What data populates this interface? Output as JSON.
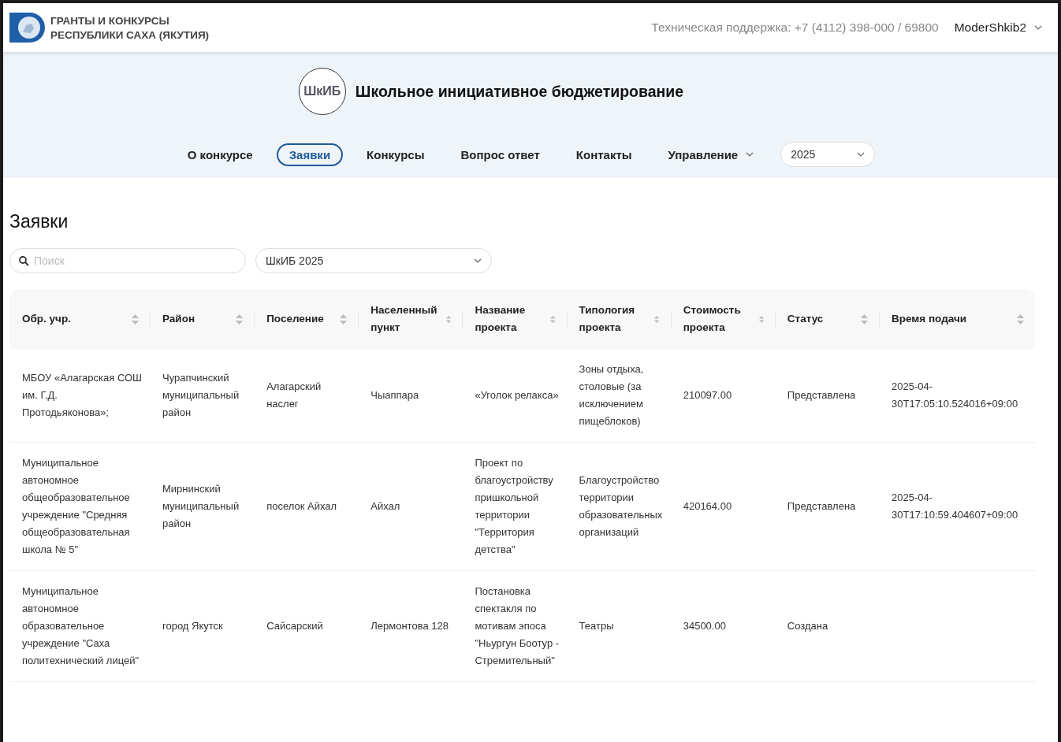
{
  "header": {
    "org_lines": [
      "ГРАНТЫ И КОНКУРСЫ",
      "РЕСПУБЛИКИ САХА (ЯКУТИЯ)"
    ],
    "support": "Техническая поддержка: +7 (4112) 398-000 / 69800",
    "user": "ModerShkib2"
  },
  "banner": {
    "logo_text": "ШкИБ",
    "title": "Школьное инициативное бюджетирование"
  },
  "nav": [
    {
      "label": "О конкурсе",
      "kind": "link",
      "selected": false
    },
    {
      "label": "Заявки",
      "kind": "link",
      "selected": true
    },
    {
      "label": "Конкурсы",
      "kind": "link",
      "selected": false
    },
    {
      "label": "Вопрос ответ",
      "kind": "link",
      "selected": false
    },
    {
      "label": "Контакты",
      "kind": "link",
      "selected": false
    },
    {
      "label": "Управление",
      "kind": "dropdown",
      "selected": false
    }
  ],
  "year_select": {
    "value": "2025"
  },
  "page_title": "Заявки",
  "search": {
    "placeholder": "Поиск"
  },
  "contest_select": {
    "value": "ШкИБ 2025"
  },
  "table": {
    "columns": [
      "Обр. учр.",
      "Район",
      "Поселение",
      "Населенный пункт",
      "Название проекта",
      "Типология проекта",
      "Стоимость проекта",
      "Статус",
      "Время подачи"
    ],
    "rows": [
      [
        "МБОУ «Алагарская СОШ им. Г.Д. Протодьяконова»;",
        "Чурапчинский муниципальный район",
        "Алагарский наслег",
        "Чыаппара",
        "«Уголок релакса»",
        "Зоны отдыха, столовые (за исключением пищеблоков)",
        "210097.00",
        "Представлена",
        "2025-04-30T17:05:10.524016+09:00"
      ],
      [
        "Муниципальное автономное общеобразовательное учреждение \"Средняя общеобразовательная школа № 5\"",
        "Мирнинский муниципальный район",
        "поселок Айхал",
        "Айхал",
        "Проект по благоустройству пришкольной территории \"Территория детства\"",
        "Благоустройство территории образовательных организаций",
        "420164.00",
        "Представлена",
        "2025-04-30T17:10:59.404607+09:00"
      ],
      [
        "Муниципальное автономное образовательное учреждение \"Саха политехнический лицей\"",
        "город Якутск",
        "Сайсарский",
        "Лермонтова 128",
        "Постановка спектакля по мотивам эпоса \"Ньургун Боотур - Стремительный\"",
        "Театры",
        "34500.00",
        "Создана",
        ""
      ]
    ]
  }
}
